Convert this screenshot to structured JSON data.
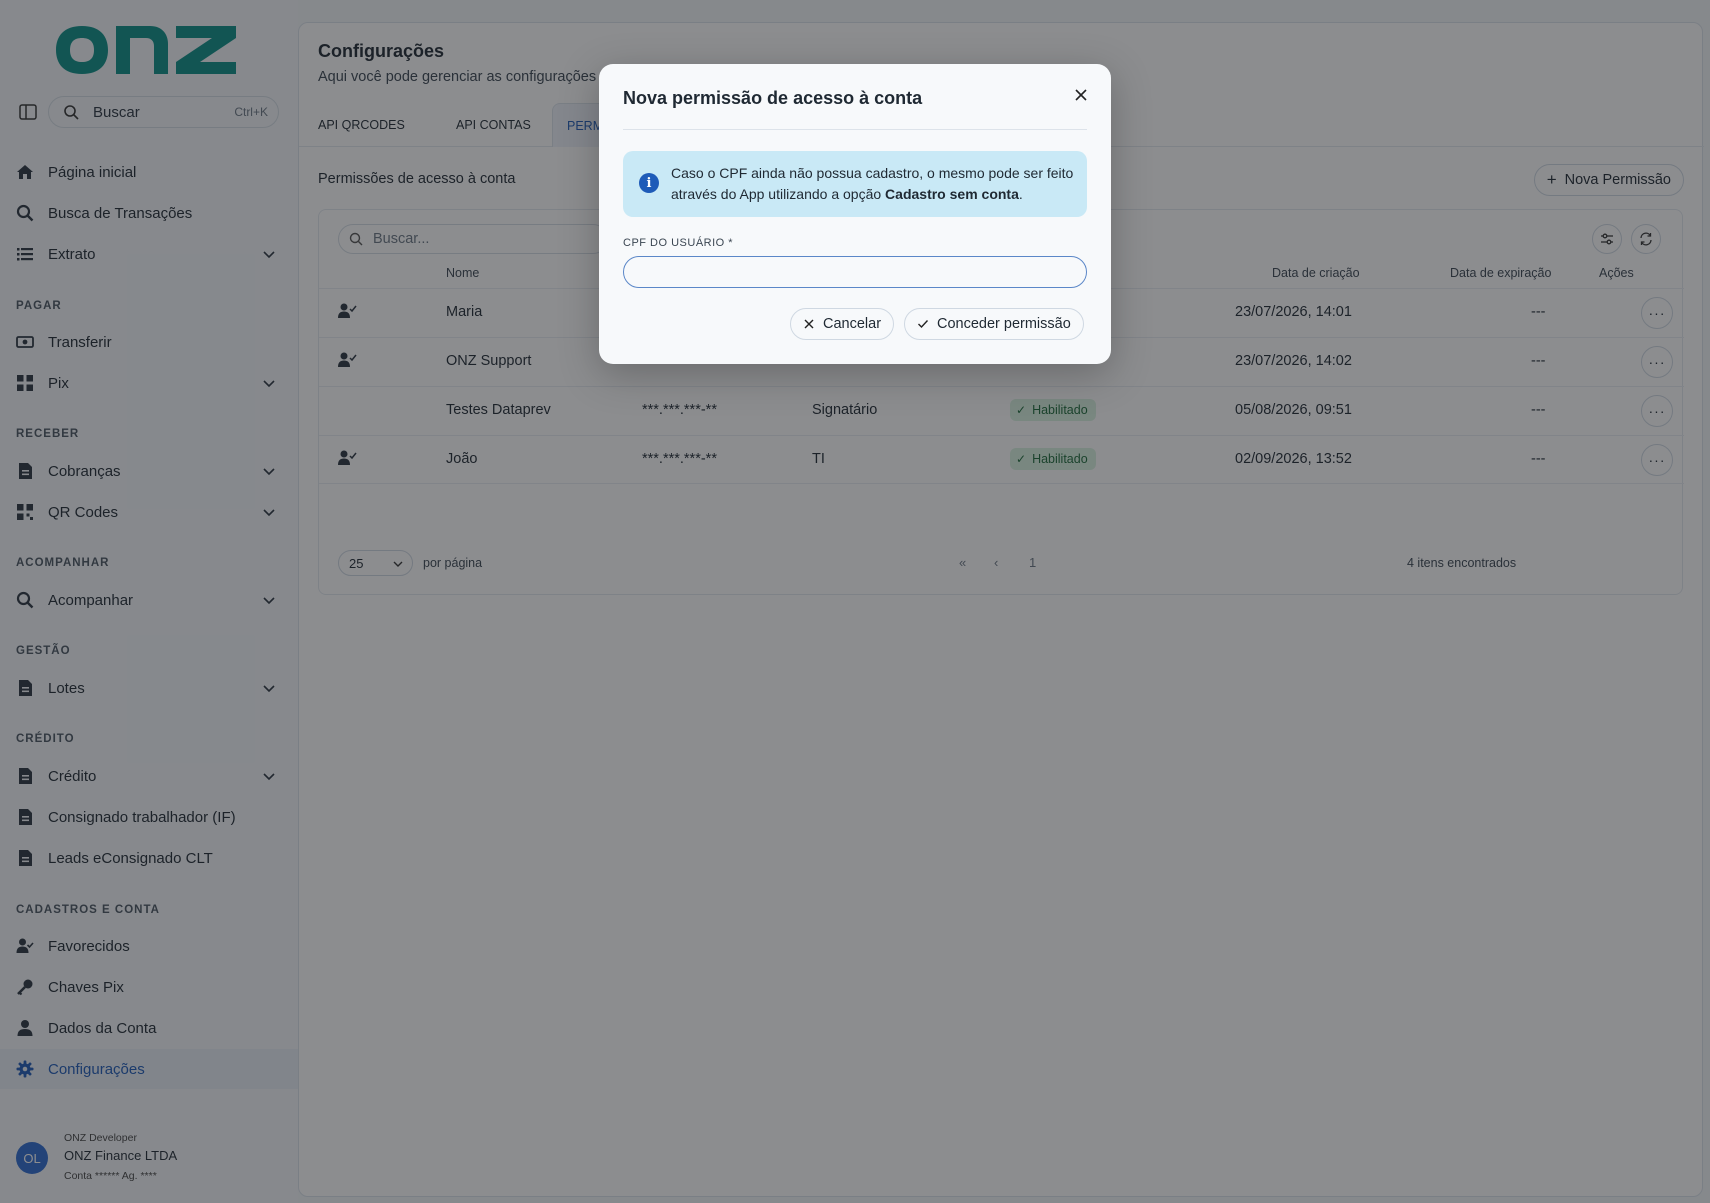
{
  "colors": {
    "brand": "#0b8f87",
    "accent": "#1e5bb8",
    "overlay": "rgba(25,28,32,0.5)",
    "badge_bg": "#d9f2e1",
    "info_bg": "#c9e9f6"
  },
  "sidebar": {
    "search": {
      "label": "Buscar",
      "shortcut": "Ctrl+K"
    },
    "items_top": [
      {
        "label": "Página inicial",
        "icon": "home-icon"
      },
      {
        "label": "Busca de Transações",
        "icon": "search-icon"
      },
      {
        "label": "Extrato",
        "icon": "list-icon"
      }
    ],
    "sections": {
      "pagar": "PAGAR",
      "receber": "RECEBER",
      "acompanhar": "ACOMPANHAR",
      "gestao": "GESTÃO",
      "credito": "CRÉDITO",
      "cadastros": "CADASTROS E CONTA"
    },
    "pagar_items": [
      {
        "label": "Transferir"
      },
      {
        "label": "Pix"
      }
    ],
    "receber_items": [
      {
        "label": "Cobranças"
      },
      {
        "label": "QR Codes"
      }
    ],
    "acompanhar_items": [
      {
        "label": "Acompanhar"
      }
    ],
    "gestao_items": [
      {
        "label": "Lotes"
      }
    ],
    "credito_items": [
      {
        "label": "Crédito"
      },
      {
        "label": "Consignado trabalhador (IF)"
      },
      {
        "label": "Leads eConsignado CLT"
      }
    ],
    "cadastros_items": [
      {
        "label": "Favorecidos"
      },
      {
        "label": "Chaves Pix"
      },
      {
        "label": "Dados da Conta"
      },
      {
        "label": "Configurações"
      }
    ],
    "user": {
      "initials": "OL",
      "role": "ONZ Developer",
      "company": "ONZ Finance LTDA",
      "account": "Conta ****** Ag. ****"
    }
  },
  "main": {
    "title": "Configurações",
    "subtitle": "Aqui você pode gerenciar as configurações",
    "tabs": [
      {
        "label": "API QRCODES"
      },
      {
        "label": "API CONTAS"
      },
      {
        "label": "PERM"
      }
    ],
    "section_title": "Permissões de acesso à conta",
    "new_button": "Nova Permissão",
    "table": {
      "search_placeholder": "Buscar...",
      "columns": {
        "name": "Nome",
        "created": "Data de criação",
        "expires": "Data de expiração",
        "actions": "Ações"
      },
      "rows": [
        {
          "name": "Maria",
          "cpf": "",
          "role": "",
          "status": "",
          "created": "23/07/2026, 14:01",
          "expires": "---"
        },
        {
          "name": "ONZ Support",
          "cpf": "",
          "role": "",
          "status": "",
          "created": "23/07/2026, 14:02",
          "expires": "---"
        },
        {
          "name": "Testes Dataprev",
          "cpf": "***.***.***-**",
          "role": "Signatário",
          "status": "Habilitado",
          "created": "05/08/2026, 09:51",
          "expires": "---"
        },
        {
          "name": "João",
          "cpf": "***.***.***-**",
          "role": "TI",
          "status": "Habilitado",
          "created": "02/09/2026, 13:52",
          "expires": "---"
        }
      ],
      "actions_label": "···"
    },
    "pager": {
      "per_page": "25",
      "per_page_label": "por página",
      "first": "«",
      "prev": "‹",
      "page": "1",
      "found": "4 itens encontrados"
    }
  },
  "modal": {
    "title": "Nova permissão de acesso à conta",
    "info_text": "Caso o CPF ainda não possua cadastro, o mesmo pode ser feito através do App utilizando a opção ",
    "info_bold": "Cadastro sem conta",
    "info_end": ".",
    "field_label": "CPF DO USUÁRIO  *",
    "field_value": "",
    "cancel_label": "Cancelar",
    "confirm_label": "Conceder permissão"
  }
}
